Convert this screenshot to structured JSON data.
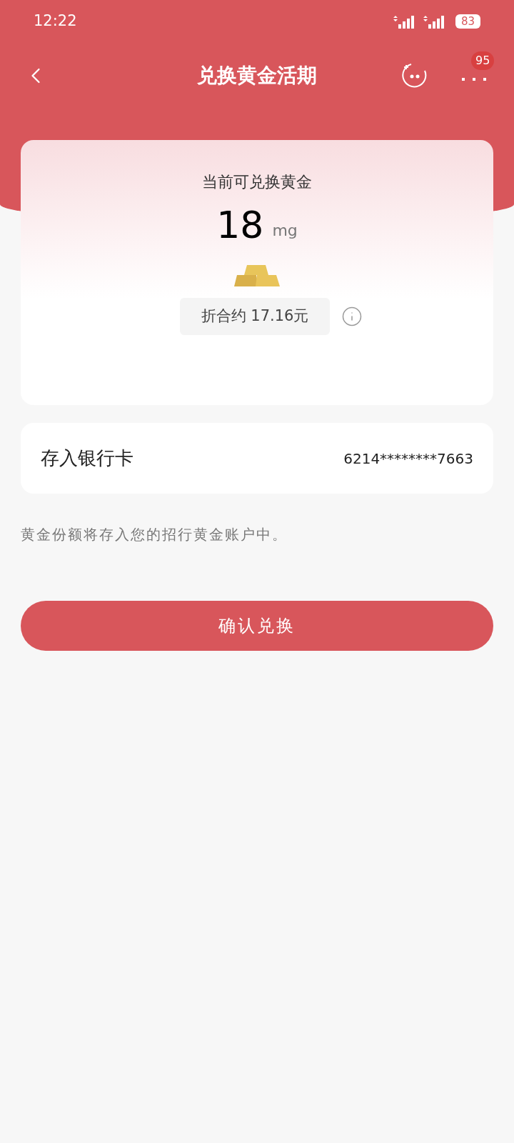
{
  "status_bar": {
    "time": "12:22",
    "battery": "83"
  },
  "nav": {
    "title": "兑换黄金活期",
    "badge": "95"
  },
  "card": {
    "label": "当前可兑换黄金",
    "amount": "18",
    "unit": "mg",
    "equivalent": "折合约 17.16元"
  },
  "bank_row": {
    "label": "存入银行卡",
    "value": "6214********7663"
  },
  "note": "黄金份额将存入您的招行黄金账户中。",
  "confirm_button": "确认兑换"
}
